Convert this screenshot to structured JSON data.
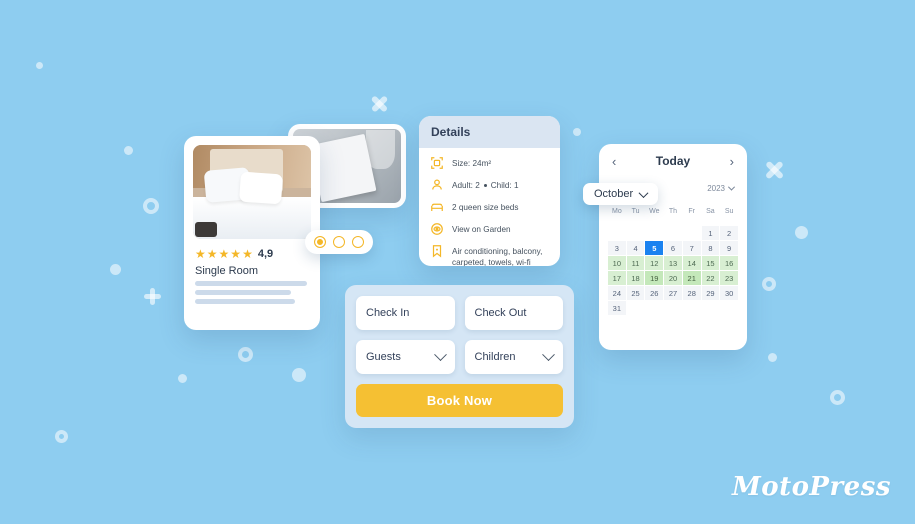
{
  "background": {
    "color": "#8ecdf0"
  },
  "room_card": {
    "rating_stars": 5,
    "rating_value": "4,9",
    "title": "Single Room",
    "star_glyph": "★"
  },
  "carousel": {
    "dots": 3,
    "active_index": 0
  },
  "details": {
    "header": "Details",
    "rows": [
      {
        "icon": "size-icon",
        "text": "Size: 24m²"
      },
      {
        "icon": "person-icon",
        "text_pre": "Adult: 2",
        "text_post": "Child: 1"
      },
      {
        "icon": "bed-icon",
        "text": "2 queen size beds"
      },
      {
        "icon": "eye-icon",
        "text": "View on Garden"
      },
      {
        "icon": "bookmark-icon",
        "text": "Air conditioning, balcony, carpeted, towels, wi-fi"
      }
    ]
  },
  "booking_form": {
    "check_in": "Check In",
    "check_out": "Check Out",
    "guests": "Guests",
    "children": "Children",
    "book_now": "Book Now",
    "accent_color": "#f5c033",
    "panel_color": "#d5e6f5"
  },
  "calendar": {
    "prev_arrow": "‹",
    "next_arrow": "›",
    "today_label": "Today",
    "month": "October",
    "year": "2023",
    "weekdays": [
      "Mo",
      "Tu",
      "We",
      "Th",
      "Fr",
      "Sa",
      "Su"
    ],
    "leading_blanks": 5,
    "today_date": 5,
    "today_color": "#1a82f0",
    "available_color": "#d8efd2",
    "available_strong_color": "#c4e8ba",
    "days": [
      {
        "n": 1,
        "state": "default"
      },
      {
        "n": 2,
        "state": "default"
      },
      {
        "n": 3,
        "state": "default"
      },
      {
        "n": 4,
        "state": "default"
      },
      {
        "n": 5,
        "state": "today"
      },
      {
        "n": 6,
        "state": "default"
      },
      {
        "n": 7,
        "state": "default"
      },
      {
        "n": 8,
        "state": "default"
      },
      {
        "n": 9,
        "state": "default"
      },
      {
        "n": 10,
        "state": "avail"
      },
      {
        "n": 11,
        "state": "avail"
      },
      {
        "n": 12,
        "state": "avail"
      },
      {
        "n": 13,
        "state": "avail"
      },
      {
        "n": 14,
        "state": "avail"
      },
      {
        "n": 15,
        "state": "avail"
      },
      {
        "n": 16,
        "state": "avail"
      },
      {
        "n": 17,
        "state": "avail"
      },
      {
        "n": 18,
        "state": "avail"
      },
      {
        "n": 19,
        "state": "avail2"
      },
      {
        "n": 20,
        "state": "avail"
      },
      {
        "n": 21,
        "state": "avail2"
      },
      {
        "n": 22,
        "state": "avail"
      },
      {
        "n": 23,
        "state": "avail"
      },
      {
        "n": 24,
        "state": "default"
      },
      {
        "n": 25,
        "state": "default"
      },
      {
        "n": 26,
        "state": "default"
      },
      {
        "n": 27,
        "state": "default"
      },
      {
        "n": 28,
        "state": "default"
      },
      {
        "n": 29,
        "state": "default"
      },
      {
        "n": 30,
        "state": "default"
      },
      {
        "n": 31,
        "state": "default"
      }
    ]
  },
  "logo": {
    "text": "MotoPress"
  }
}
